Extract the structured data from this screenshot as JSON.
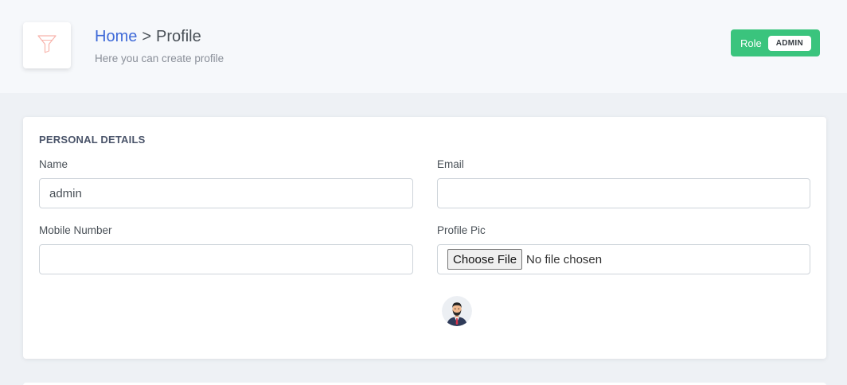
{
  "header": {
    "breadcrumb": {
      "home": "Home",
      "separator": ">",
      "current": "Profile"
    },
    "subtitle": "Here you can create profile",
    "icon": "funnel-icon",
    "role": {
      "label": "Role",
      "value": "ADMIN"
    }
  },
  "card": {
    "title": "PERSONAL DETAILS",
    "fields": {
      "name": {
        "label": "Name",
        "value": "admin",
        "placeholder": ""
      },
      "email": {
        "label": "Email",
        "value": "",
        "placeholder": ""
      },
      "mobile": {
        "label": "Mobile Number",
        "value": "",
        "placeholder": ""
      },
      "profile_pic": {
        "label": "Profile Pic",
        "button": "Choose File",
        "status": "No file chosen"
      }
    },
    "avatar_icon": "user-avatar-icon"
  },
  "colors": {
    "accent": "#3f6ad8",
    "role_button": "#3ac47d",
    "icon_tint": "#f8b4ac"
  }
}
